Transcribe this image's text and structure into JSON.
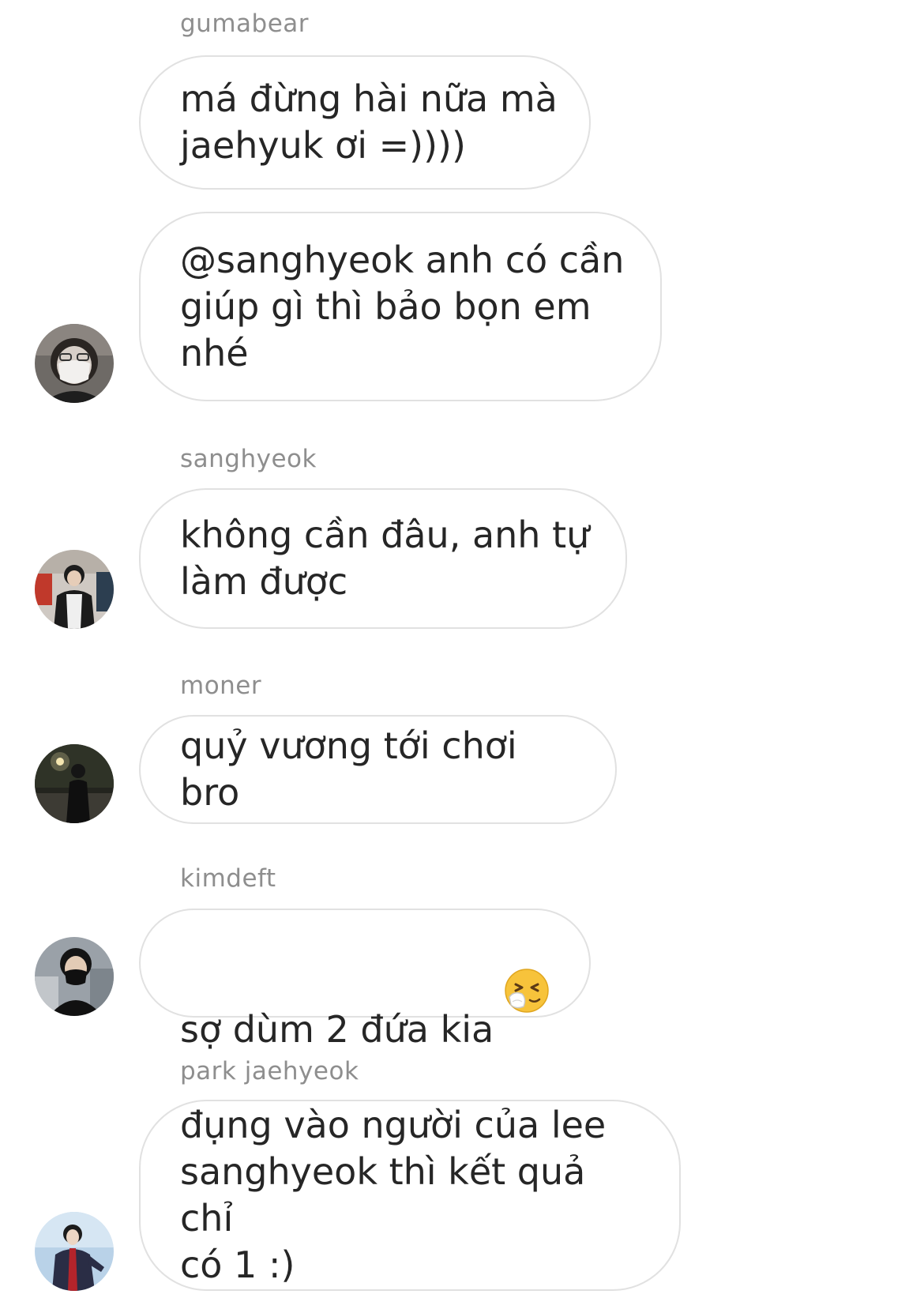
{
  "messages": [
    {
      "sender": "gumabear",
      "text": "má đừng hài nữa mà\njaehyuk ơi =))))"
    },
    {
      "sender": "",
      "text": "@sanghyeok anh có cần\ngiúp gì thì bảo bọn em\nnhé",
      "avatar_icon": "avatar-masked-icon"
    },
    {
      "sender": "sanghyeok",
      "text": "không cần đâu, anh tự\nlàm được",
      "avatar_icon": "avatar-puffer-jacket-icon"
    },
    {
      "sender": "moner",
      "text": "quỷ vương tới chơi bro",
      "avatar_icon": "avatar-night-icon"
    },
    {
      "sender": "kimdeft",
      "text": "sợ dùm 2 đứa kia",
      "emoji": "sneezing-face-icon",
      "avatar_icon": "avatar-black-mask-icon"
    },
    {
      "sender": "park jaehyeok",
      "text": "đụng vào người của lee\nsanghyeok thì kết quả chỉ\ncó 1 :)",
      "avatar_icon": "avatar-tracksuit-icon"
    }
  ],
  "colors": {
    "sender_text": "#8e8e8e",
    "message_text": "#262626",
    "bubble_border": "#e1e1e1",
    "background": "#ffffff"
  }
}
